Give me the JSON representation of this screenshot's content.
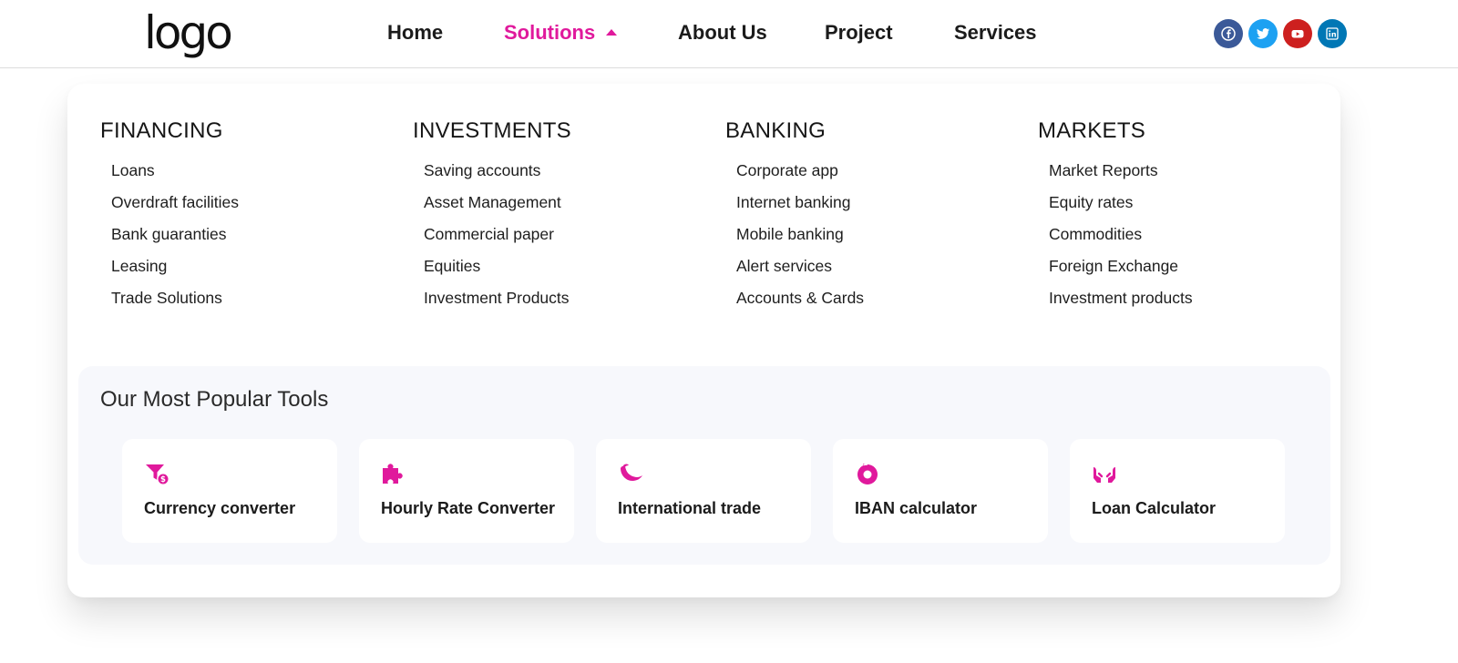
{
  "header": {
    "logo_text": "logo",
    "nav": [
      {
        "label": "Home",
        "active": false
      },
      {
        "label": "Solutions",
        "active": true
      },
      {
        "label": "About Us",
        "active": false
      },
      {
        "label": "Project",
        "active": false
      },
      {
        "label": "Services",
        "active": false
      }
    ],
    "socials": [
      {
        "icon": "facebook-icon",
        "color": "#3b5998"
      },
      {
        "icon": "twitter-icon",
        "color": "#1da1f2"
      },
      {
        "icon": "youtube-icon",
        "color": "#cd201f"
      },
      {
        "icon": "linkedin-icon",
        "color": "#0077b5"
      }
    ]
  },
  "mega_menu": {
    "columns": [
      {
        "title": "FINANCING",
        "links": [
          "Loans",
          "Overdraft facilities",
          "Bank guaranties",
          "Leasing",
          "Trade Solutions"
        ]
      },
      {
        "title": "INVESTMENTS",
        "links": [
          "Saving accounts",
          "Asset Management",
          "Commercial paper",
          "Equities",
          "Investment Products"
        ]
      },
      {
        "title": "BANKING",
        "links": [
          "Corporate app",
          "Internet banking",
          "Mobile banking",
          "Alert services",
          "Accounts & Cards"
        ]
      },
      {
        "title": "MARKETS",
        "links": [
          "Market Reports",
          "Equity rates",
          "Commodities",
          "Foreign Exchange",
          "Investment products"
        ]
      }
    ],
    "tools": {
      "title": "Our Most Popular Tools",
      "items": [
        {
          "label": "Currency converter",
          "icon": "funnel-dollar-icon"
        },
        {
          "label": "Hourly Rate Converter",
          "icon": "puzzle-icon"
        },
        {
          "label": "International trade",
          "icon": "crescent-wave-icon"
        },
        {
          "label": "IBAN calculator",
          "icon": "refresh-icon"
        },
        {
          "label": "Loan Calculator",
          "icon": "hands-icon"
        }
      ]
    }
  },
  "colors": {
    "accent": "#e0199c",
    "panel_bg": "#ffffff",
    "tools_bg": "#f7f8fc",
    "text": "#1b1b1b"
  }
}
